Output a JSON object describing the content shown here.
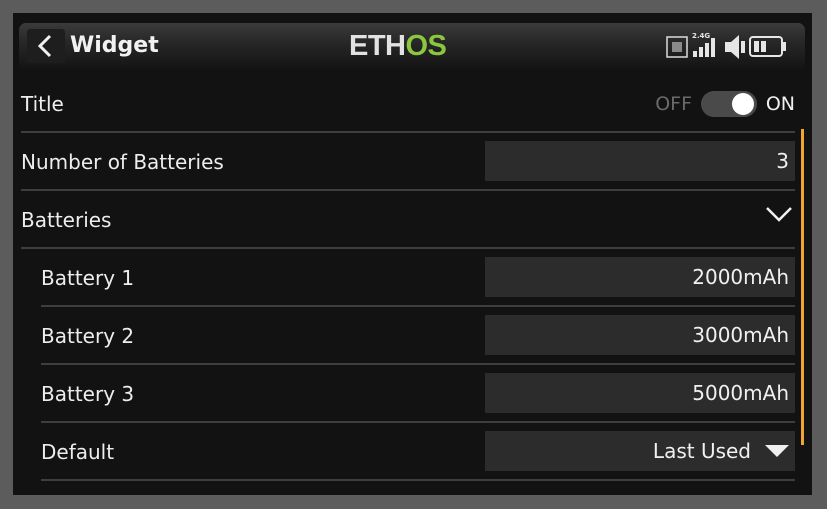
{
  "header": {
    "title": "Widget",
    "logo": {
      "part1": "ETH",
      "part2": "OS"
    },
    "status": {
      "rf_band": "2.4G"
    }
  },
  "rows": {
    "title": {
      "label": "Title",
      "toggle_off": "OFF",
      "toggle_on": "ON",
      "state": "on"
    },
    "num_batteries": {
      "label": "Number of Batteries",
      "value": "3"
    },
    "batteries": {
      "label": "Batteries",
      "expanded": true
    },
    "battery1": {
      "label": "Battery 1",
      "value": "2000mAh"
    },
    "battery2": {
      "label": "Battery 2",
      "value": "3000mAh"
    },
    "battery3": {
      "label": "Battery 3",
      "value": "5000mAh"
    },
    "default": {
      "label": "Default",
      "value": "Last Used"
    }
  },
  "icons": [
    "back-icon",
    "sd-card-icon",
    "signal-icon",
    "speaker-icon",
    "battery-icon",
    "chevron-down-icon",
    "triangle-down-icon"
  ],
  "colors": {
    "accent_green": "#8cc63f",
    "scrollbar": "#f0a532",
    "background": "#121212"
  }
}
